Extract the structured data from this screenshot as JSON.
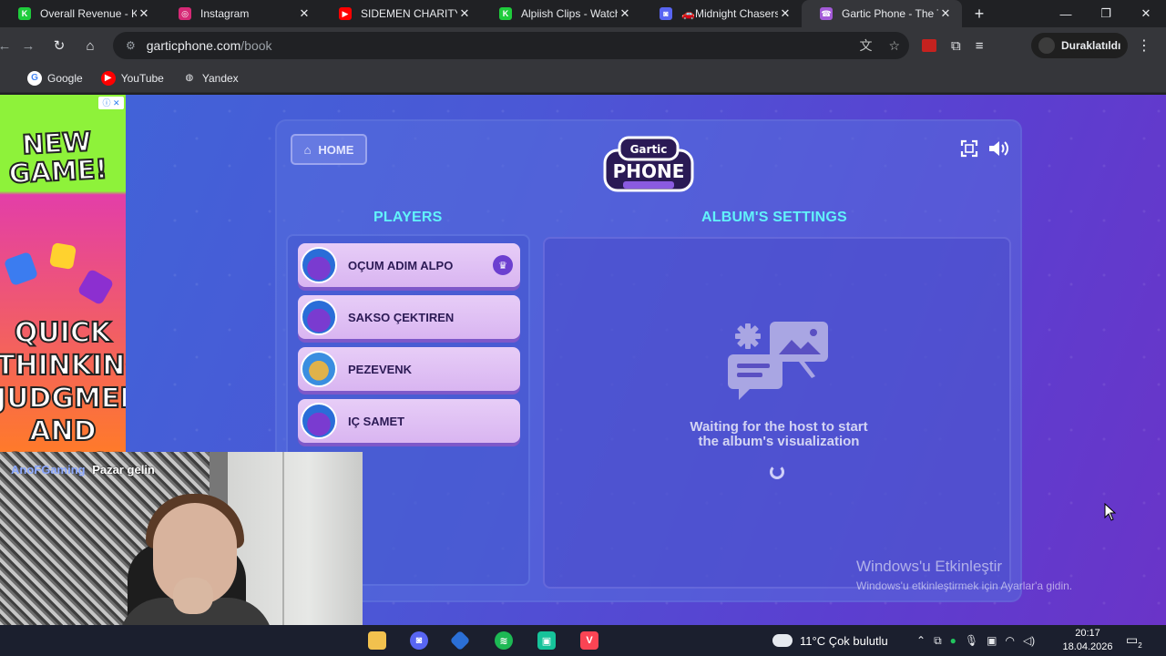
{
  "browser": {
    "tabs": [
      {
        "title": "Overall Revenue - Kick",
        "favicon": "kick-icon",
        "color": "#1fcc3c",
        "glyph": "K"
      },
      {
        "title": "Instagram",
        "favicon": "instagram-icon",
        "color": "#d62976",
        "glyph": "◎"
      },
      {
        "title": "SIDEMEN CHARITY MATCH",
        "favicon": "youtube-icon",
        "color": "#ff0000",
        "glyph": "▶"
      },
      {
        "title": "Alpiish Clips - Watch",
        "favicon": "kick-icon",
        "color": "#1fcc3c",
        "glyph": "K"
      },
      {
        "title": "🚗Midnight Chasers",
        "favicon": "discord-icon",
        "color": "#5865f2",
        "glyph": "◙"
      },
      {
        "title": "Gartic Phone - The Telephone Game",
        "favicon": "gartic-icon",
        "color": "#a35ad8",
        "glyph": "☎",
        "active": true
      }
    ],
    "url": {
      "host": "garticphone.com",
      "path": "/book"
    },
    "profile_label": "Duraklatıldı",
    "bookmarks": [
      {
        "label": "Google",
        "icon": "google-icon",
        "color": "#ffffff",
        "glyph": "G",
        "glyphColor": "#4285f4"
      },
      {
        "label": "YouTube",
        "icon": "youtube-icon",
        "color": "#ff0000",
        "glyph": "▶",
        "glyphColor": "#ffffff"
      },
      {
        "label": "Yandex",
        "icon": "globe-icon",
        "color": "#35363a",
        "glyph": "◍",
        "glyphColor": "#e8eaed"
      }
    ]
  },
  "ad": {
    "headline": "NEW GAME!",
    "tagline": "QUICK THINKING, JUDGMENT AND CHAOS!"
  },
  "game": {
    "home_label": "HOME",
    "players_title": "PLAYERS",
    "album_title": "ALBUM'S SETTINGS",
    "players": [
      {
        "name": "OÇUM ADIM ALPO",
        "host": true,
        "avatar": "purple-bird-avatar"
      },
      {
        "name": "SAKSO ÇEKTIREN",
        "host": false,
        "avatar": "purple-bird-avatar"
      },
      {
        "name": "PEZEVENK",
        "host": false,
        "avatar": "masked-avatar"
      },
      {
        "name": "IÇ SAMET",
        "host": false,
        "avatar": "purple-bird-avatar"
      }
    ],
    "waiting_text_line1": "Waiting for the host to start",
    "waiting_text_line2": "the album's visualization"
  },
  "windows_activation": {
    "title": "Windows'u Etkinleştir",
    "subtitle": "Windows'u etkinleştirmek için Ayarlar'a gidin."
  },
  "webcam": {
    "username": "AnoFGaming",
    "message": "Pazar gelin"
  },
  "taskbar": {
    "weather": "11°C  Çok bulutlu",
    "time": "20:17",
    "date": "18.04.2026",
    "notification_count": "2"
  }
}
